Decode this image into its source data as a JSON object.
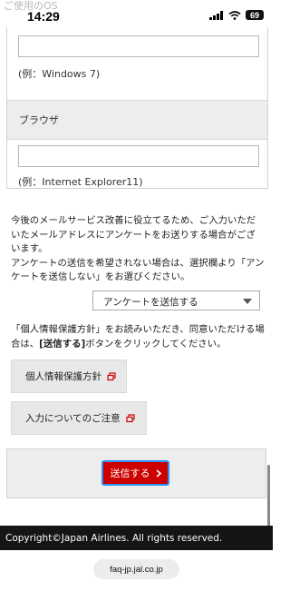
{
  "status_bar": {
    "time": "14:29",
    "battery": "69",
    "ghost_label": "ご使用のOS"
  },
  "form": {
    "os_hint": "(例：Windows 7)",
    "browser_section_label": "ブラウザ",
    "browser_hint": "(例：Internet Explorer11)"
  },
  "survey": {
    "notice": "今後のメールサービス改善に役立てるため、ご入力いただいたメールアドレスにアンケートをお送りする場合がございます。\nアンケートの送信を希望されない場合は、選択欄より「アンケートを送信しない」をお選びください。",
    "select_value": "アンケートを送信する"
  },
  "privacy": {
    "text_before": "「個人情報保護方針」をお読みいただき、同意いただける場合は、",
    "text_bold": "[送信する]",
    "text_after": "ボタンをクリックしてください。",
    "policy_button": "個人情報保護方針",
    "input_notes_button": "入力についてのご注意"
  },
  "submit": {
    "label": "送信する"
  },
  "footer": {
    "copyright": "Copyright©Japan Airlines. All rights reserved."
  },
  "browser": {
    "url": "faq-jp.jal.co.jp"
  },
  "colors": {
    "submit_bg": "#cc0000",
    "submit_border": "#2a8ff7",
    "footer_bg": "#151515",
    "section_bg": "#ededed"
  }
}
